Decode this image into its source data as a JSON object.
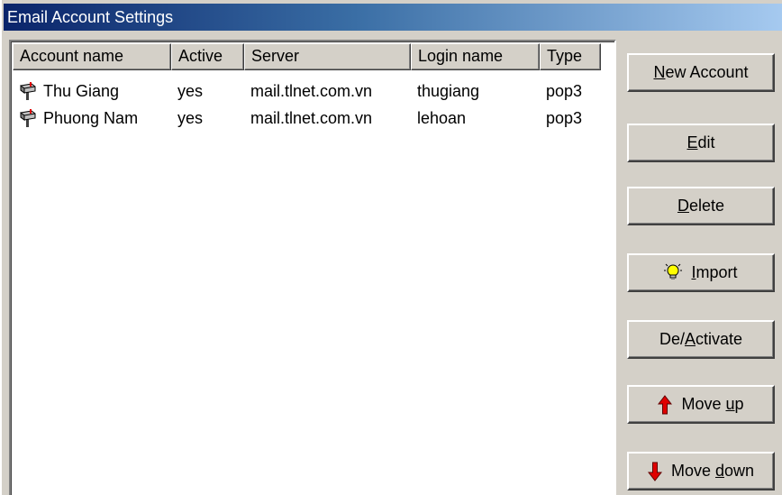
{
  "window": {
    "title": "Email Account Settings"
  },
  "table": {
    "columns": [
      "Account name",
      "Active",
      "Server",
      "Login name",
      "Type"
    ],
    "rows": [
      {
        "account_name": "Thu Giang",
        "active": "yes",
        "server": "mail.tlnet.com.vn",
        "login_name": "thugiang",
        "type": "pop3",
        "icon": "mailbox-icon"
      },
      {
        "account_name": "Phuong Nam",
        "active": "yes",
        "server": "mail.tlnet.com.vn",
        "login_name": "lehoan",
        "type": "pop3",
        "icon": "mailbox-icon"
      }
    ]
  },
  "buttons": {
    "new_account": {
      "pre": "",
      "key": "N",
      "post": "ew Account"
    },
    "edit": {
      "pre": "",
      "key": "E",
      "post": "dit"
    },
    "delete": {
      "pre": "",
      "key": "D",
      "post": "elete"
    },
    "import": {
      "pre": "",
      "key": "I",
      "post": "mport",
      "icon": "lightbulb-icon"
    },
    "deactivate": {
      "pre": "De/",
      "key": "A",
      "post": "ctivate"
    },
    "move_up": {
      "pre": "Move ",
      "key": "u",
      "post": "p",
      "icon": "arrow-up-icon"
    },
    "move_down": {
      "pre": "Move ",
      "key": "d",
      "post": "own",
      "icon": "arrow-down-icon"
    }
  },
  "colors": {
    "title_bar_start": "#0a246a",
    "title_bar_end": "#a6caf0",
    "arrow_red": "#e00000",
    "bulb_yellow": "#ffff00"
  }
}
